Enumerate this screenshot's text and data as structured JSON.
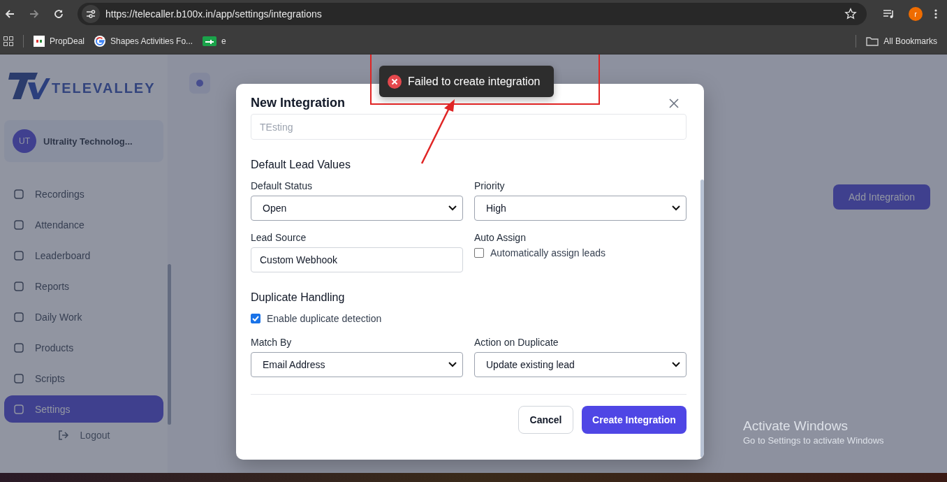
{
  "browser": {
    "url": "https://telecaller.b100x.in/app/settings/integrations",
    "profile_initial": "r",
    "all_bookmarks": "All Bookmarks",
    "bookmarks": [
      {
        "kind": "pd",
        "label": "PropDeal"
      },
      {
        "kind": "google",
        "label": "Shapes Activities Fo..."
      },
      {
        "kind": "sheet",
        "label": "e"
      }
    ]
  },
  "sidebar": {
    "logo_text": "TELEVALLEY",
    "user": {
      "initials": "UT",
      "name": "Ultrality Technolog..."
    },
    "items": [
      {
        "label": "Recordings",
        "selected": false
      },
      {
        "label": "Attendance",
        "selected": false
      },
      {
        "label": "Leaderboard",
        "selected": false
      },
      {
        "label": "Reports",
        "selected": false
      },
      {
        "label": "Daily Work",
        "selected": false
      },
      {
        "label": "Products",
        "selected": false
      },
      {
        "label": "Scripts",
        "selected": false
      },
      {
        "label": "Settings",
        "selected": true
      }
    ],
    "logout": "Logout"
  },
  "page": {
    "add_button": "Add Integration"
  },
  "toast": {
    "kind": "error",
    "message": "Failed to create integration"
  },
  "modal": {
    "title": "New Integration",
    "name_value": "TEsting",
    "sections": [
      {
        "heading": "Default Lead Values",
        "fields": [
          {
            "kind": "select",
            "label": "Default Status",
            "value": "Open"
          },
          {
            "kind": "select",
            "label": "Priority",
            "value": "High"
          },
          {
            "kind": "text",
            "label": "Lead Source",
            "value": "Custom Webhook"
          },
          {
            "kind": "checkbox",
            "label": "Auto Assign",
            "option": "Automatically assign leads",
            "checked": false
          }
        ]
      },
      {
        "heading": "Duplicate Handling",
        "toggle": {
          "label": "Enable duplicate detection",
          "checked": true
        },
        "fields": [
          {
            "kind": "select",
            "label": "Match By",
            "value": "Email Address"
          },
          {
            "kind": "select",
            "label": "Action on Duplicate",
            "value": "Update existing lead"
          }
        ]
      }
    ],
    "buttons": [
      {
        "kind": "secondary",
        "label": "Cancel"
      },
      {
        "kind": "primary",
        "label": "Create Integration"
      }
    ]
  },
  "os_notice": {
    "title": "Activate Windows",
    "text": "Go to Settings to activate Windows"
  }
}
